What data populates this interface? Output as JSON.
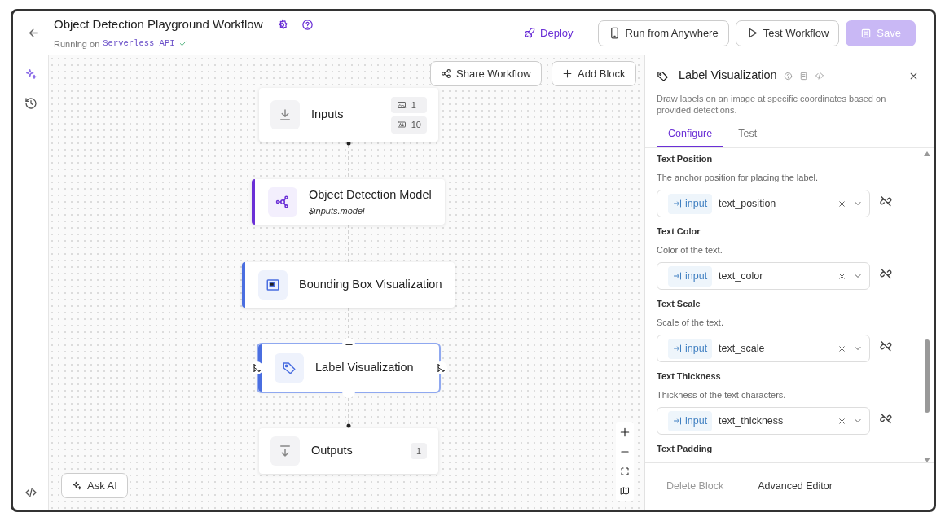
{
  "header": {
    "title": "Object Detection Playground Workflow",
    "running_label": "Running on",
    "runtime": "Serverless API",
    "connected": true,
    "deploy": "Deploy",
    "buttons": [
      {
        "label": "Run from Anywhere",
        "kind": "phone"
      },
      {
        "label": "Test Workflow",
        "kind": "play"
      }
    ],
    "save": {
      "label": "Save",
      "disabled": true
    }
  },
  "rail": [
    {
      "kind": "ai",
      "selected": true
    },
    {
      "kind": "history",
      "selected": false
    },
    {
      "kind": "code",
      "selected": false
    }
  ],
  "canvas": {
    "toolbar": [
      {
        "label": "Share Workflow",
        "kind": "share"
      },
      {
        "label": "Add Block",
        "kind": "add"
      }
    ],
    "nodes": [
      {
        "kind": "inputs",
        "title": "Inputs",
        "selected": false,
        "badges": [
          {
            "kind": "image",
            "count": "1"
          },
          {
            "kind": "text",
            "count": "10"
          }
        ]
      },
      {
        "kind": "model",
        "title": "Object Detection Model",
        "subtitle": "$inputs.model",
        "color": "#6a2fd6",
        "selected": false
      },
      {
        "kind": "bbox",
        "title": "Bounding Box Visualization",
        "color": "#4a6ee0",
        "selected": false
      },
      {
        "kind": "label",
        "title": "Label Visualization",
        "color": "#4a6ee0",
        "selected": true
      },
      {
        "kind": "outputs",
        "title": "Outputs",
        "selected": false,
        "badges": [
          {
            "kind": "plain",
            "count": "1"
          }
        ]
      }
    ],
    "ask_ai": "Ask AI"
  },
  "panel": {
    "title": "Label Visualization",
    "description": "Draw labels on an image at specific coordinates based on provided detections.",
    "tabs": [
      {
        "label": "Configure",
        "selected": true
      },
      {
        "label": "Test",
        "selected": false
      }
    ],
    "fields": [
      {
        "label": "Text Position",
        "description": "The anchor position for placing the label.",
        "source": "input",
        "value": "text_position"
      },
      {
        "label": "Text Color",
        "description": "Color of the text.",
        "source": "input",
        "value": "text_color"
      },
      {
        "label": "Text Scale",
        "description": "Scale of the text.",
        "source": "input",
        "value": "text_scale"
      },
      {
        "label": "Text Thickness",
        "description": "Thickness of the text characters.",
        "source": "input",
        "value": "text_thickness"
      },
      {
        "label": "Text Padding"
      }
    ],
    "footer": [
      {
        "label": "Delete Block",
        "disabled": true
      },
      {
        "label": "Advanced Editor",
        "disabled": false
      }
    ]
  }
}
